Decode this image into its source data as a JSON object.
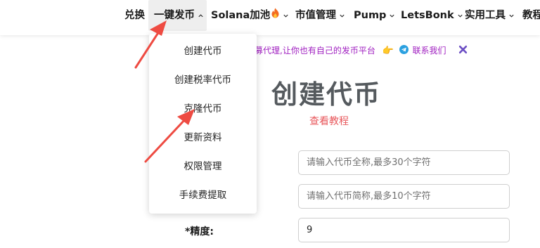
{
  "nav": {
    "items": [
      {
        "label": "兑换",
        "has_chevron": false
      },
      {
        "label": "一键发币",
        "has_chevron": true,
        "active": true
      },
      {
        "label": "Solana加池",
        "has_chevron": true,
        "icon": "flame-icon"
      },
      {
        "label": "市值管理",
        "has_chevron": true
      },
      {
        "label": "Pump",
        "has_chevron": true
      },
      {
        "label": "LetsBonk",
        "has_chevron": true
      },
      {
        "label": "实用工具",
        "has_chevron": true
      },
      {
        "label": "教程",
        "has_chevron": false
      }
    ]
  },
  "dropdown": {
    "items": [
      "创建代币",
      "创建税率代币",
      "克隆代币",
      "更新资料",
      "权限管理",
      "手续费提取"
    ]
  },
  "announcement": {
    "text": "招募代理,让你也有自己的发币平台",
    "hand_icon": "👉",
    "telegram_icon": "telegram-icon",
    "contact": "联系我们",
    "close_icon": "close-icon"
  },
  "main": {
    "title": "创建代币",
    "tutorial_link": "查看教程"
  },
  "form": {
    "token_name_placeholder": "请输入代币全称,最多30个字符",
    "token_symbol_placeholder": "请输入代币简称,最多10个字符",
    "decimals_label": "*精度:",
    "decimals_value": "9"
  },
  "colors": {
    "accent_purple": "#a020c0",
    "link_red": "#e8575b",
    "arrow_red": "#ee4b42",
    "title_gray": "#555a5e"
  }
}
